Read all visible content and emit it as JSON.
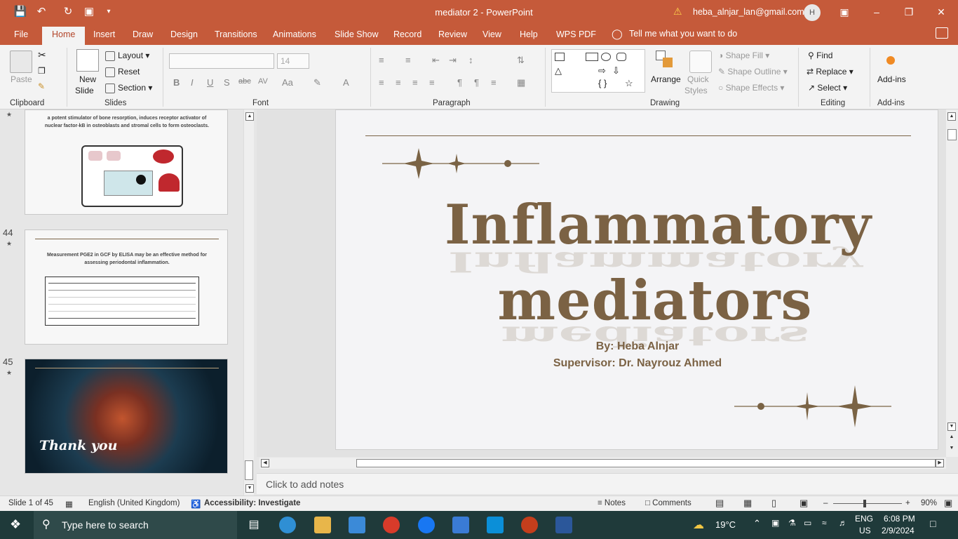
{
  "window": {
    "title": "mediator 2  -  PowerPoint",
    "account": "heba_alnjar_lan@gmail.com",
    "avatar_initial": "H"
  },
  "tabs": [
    "File",
    "Home",
    "Insert",
    "Draw",
    "Design",
    "Transitions",
    "Animations",
    "Slide Show",
    "Record",
    "Review",
    "View",
    "Help",
    "WPS PDF"
  ],
  "active_tab": "Home",
  "tell_me": "Tell me what you want to do",
  "ribbon": {
    "clipboard": {
      "label": "Clipboard",
      "paste": "Paste"
    },
    "slides": {
      "label": "Slides",
      "new_slide_1": "New",
      "new_slide_2": "Slide",
      "layout": "Layout",
      "reset": "Reset",
      "section": "Section"
    },
    "font": {
      "label": "Font",
      "size": "14"
    },
    "paragraph": {
      "label": "Paragraph"
    },
    "drawing": {
      "label": "Drawing",
      "arrange": "Arrange",
      "quick_styles_1": "Quick",
      "quick_styles_2": "Styles",
      "shape_fill": "Shape Fill",
      "shape_outline": "Shape Outline",
      "shape_effects": "Shape Effects"
    },
    "editing": {
      "label": "Editing",
      "find": "Find",
      "replace": "Replace",
      "select": "Select"
    },
    "addins": {
      "label": "Add-ins",
      "button": "Add-ins"
    }
  },
  "thumbnails": [
    {
      "number": "",
      "text": "a potent stimulator of bone resorption, induces receptor activator of nuclear factor-kB in osteoblasts and stromal cells to form osteoclasts."
    },
    {
      "number": "44",
      "text": "Measurement PGE2 in GCF by ELISA may be an effective method for assessing periodontal inflammation."
    },
    {
      "number": "45",
      "text": "Thank you"
    }
  ],
  "slide": {
    "title_line1": "Inflammatory",
    "title_line2": "mediators",
    "by": "By: Heba Alnjar",
    "supervisor": "Supervisor: Dr. Nayrouz Ahmed"
  },
  "notes_placeholder": "Click to add notes",
  "status": {
    "slide": "Slide 1 of 45",
    "language": "English (United Kingdom)",
    "accessibility": "Accessibility: Investigate",
    "notes": "Notes",
    "comments": "Comments",
    "zoom": "90%"
  },
  "taskbar": {
    "search": "Type here to search",
    "weather": "19°C",
    "lang1": "ENG",
    "lang2": "US",
    "time": "6:08 PM",
    "date": "2/9/2024"
  },
  "colors": {
    "accent": "#c55a3a",
    "slide_text": "#7b6244"
  }
}
